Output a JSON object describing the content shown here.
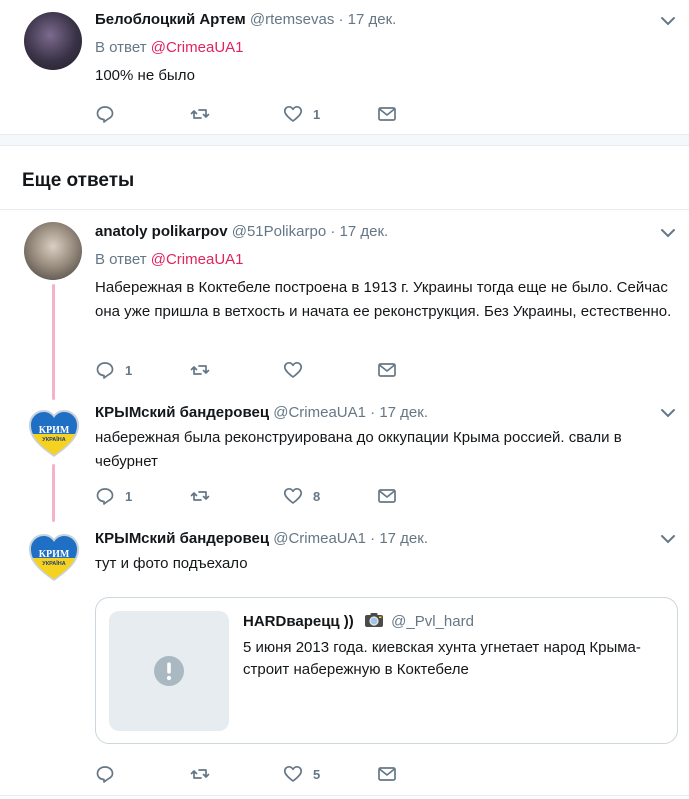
{
  "tweets": [
    {
      "name": "Белоблоцкий Артем",
      "handle": "@rtemsevas",
      "dot": "·",
      "date": "17 дек.",
      "reply_prefix": "В ответ",
      "reply_mention": "@CrimeaUA1",
      "text": "100% не было",
      "counts": {
        "reply": "",
        "retweet": "",
        "like": "1"
      }
    },
    {
      "name": "anatoly polikarpov",
      "handle": "@51Polikarpo",
      "dot": "·",
      "date": "17 дек.",
      "reply_prefix": "В ответ",
      "reply_mention": "@CrimeaUA1",
      "text": "Набережная в Коктебеле построена в 1913 г. Украины тогда еще не было. Сейчас она уже пришла в ветхость и начата ее реконструкция. Без Украины, естественно.",
      "counts": {
        "reply": "1",
        "retweet": "",
        "like": ""
      }
    },
    {
      "name": "КРЫМский бандеровец",
      "handle": "@CrimeaUA1",
      "dot": "·",
      "date": "17 дек.",
      "text": "набережная была реконструирована до оккупации Крыма россией. свали в чебурнет",
      "counts": {
        "reply": "1",
        "retweet": "",
        "like": "8"
      }
    },
    {
      "name": "КРЫМский бандеровец",
      "handle": "@CrimeaUA1",
      "dot": "·",
      "date": "17 дек.",
      "text": "тут и фото подъехало",
      "counts": {
        "reply": "",
        "retweet": "",
        "like": "5"
      },
      "quote": {
        "name": "HARDварецц ))",
        "handle": "@_Pvl_hard",
        "text": "5 июня 2013 года. киевская хунта угнетает народ Крыма- строит набережную в Коктебеле"
      }
    }
  ],
  "section_title": "Еще ответы",
  "avatar_badge_text": "КРИМ",
  "avatar_badge_sub": "УКРАЇНА",
  "colors": {
    "accent": "#e0245e",
    "muted": "#657786",
    "link": "#1da1f2",
    "divider": "#e6ecf0"
  },
  "icons": [
    "reply-icon",
    "retweet-icon",
    "like-icon",
    "direct-message-icon",
    "chevron-down-icon",
    "camera-icon",
    "warning-icon"
  ]
}
